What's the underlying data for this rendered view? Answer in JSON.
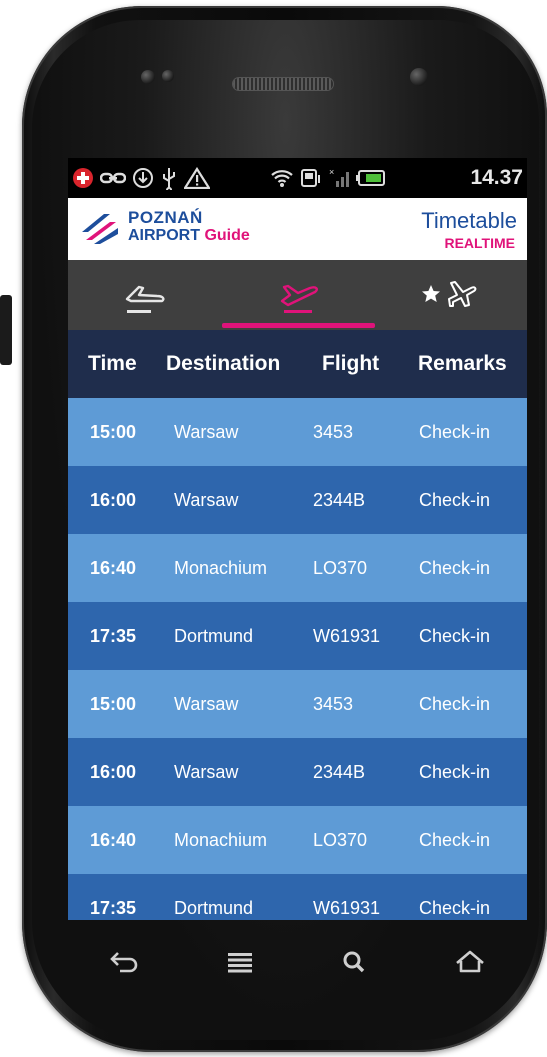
{
  "status_bar": {
    "time": "14.37",
    "icons": [
      "notification-icon",
      "link-icon",
      "download-icon",
      "usb-icon",
      "warning-icon",
      "wifi-icon",
      "storage-icon",
      "signal-icon",
      "battery-icon"
    ]
  },
  "header": {
    "brand_line1": "POZNAŃ",
    "brand_line2": "AIRPORT",
    "brand_guide": "Guide",
    "title": "Timetable",
    "subtitle": "REALTIME"
  },
  "tabs": [
    {
      "icon": "arrivals-icon",
      "active": false
    },
    {
      "icon": "departures-icon",
      "active": true
    },
    {
      "icon": "favorite-flights-icon",
      "active": false
    }
  ],
  "table": {
    "columns": [
      "Time",
      "Destination",
      "Flight",
      "Remarks"
    ],
    "rows": [
      {
        "time": "15:00",
        "destination": "Warsaw",
        "flight": "3453",
        "remarks": "Check-in"
      },
      {
        "time": "16:00",
        "destination": "Warsaw",
        "flight": "2344B",
        "remarks": "Check-in"
      },
      {
        "time": "16:40",
        "destination": "Monachium",
        "flight": "LO370",
        "remarks": "Check-in"
      },
      {
        "time": "17:35",
        "destination": "Dortmund",
        "flight": "W61931",
        "remarks": "Check-in"
      },
      {
        "time": "15:00",
        "destination": "Warsaw",
        "flight": "3453",
        "remarks": "Check-in"
      },
      {
        "time": "16:00",
        "destination": "Warsaw",
        "flight": "2344B",
        "remarks": "Check-in"
      },
      {
        "time": "16:40",
        "destination": "Monachium",
        "flight": "LO370",
        "remarks": "Check-in"
      },
      {
        "time": "17:35",
        "destination": "Dortmund",
        "flight": "W61931",
        "remarks": "Check-in"
      }
    ]
  },
  "nav_bar": [
    "back-icon",
    "menu-icon",
    "search-icon",
    "home-icon"
  ],
  "colors": {
    "brand_blue": "#1d4e9c",
    "accent_pink": "#e0137a",
    "row_light": "#5e9bd6",
    "row_dark": "#2e66ad",
    "table_header": "#1f2d4c",
    "tab_bar": "#3f3f3f"
  }
}
